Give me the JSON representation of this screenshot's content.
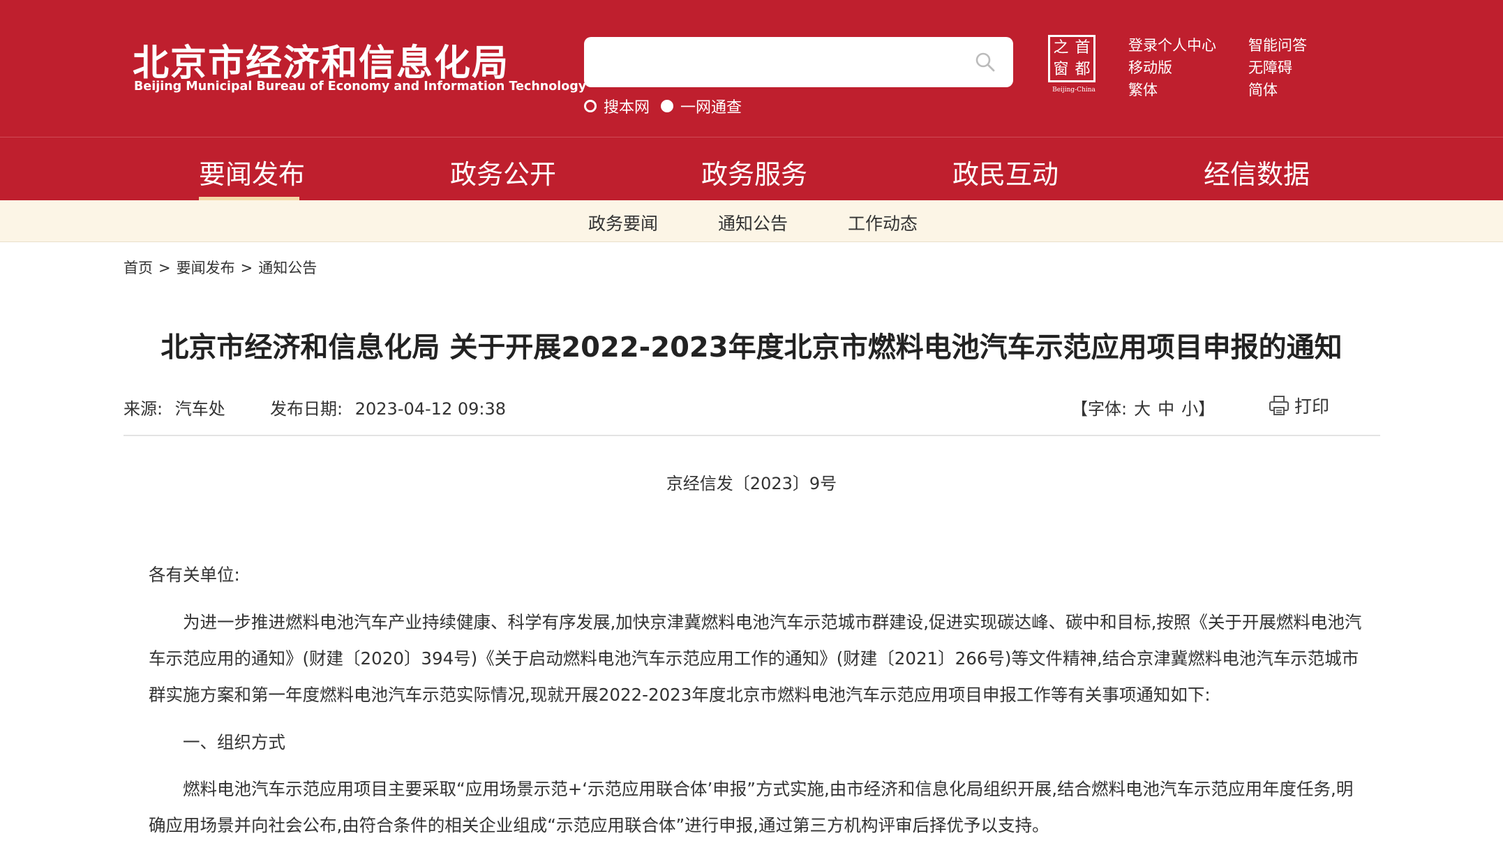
{
  "header": {
    "org_name_cn": "北京市经济和信息化局",
    "org_name_en": "Beijing Municipal Bureau of Economy and Information Technology",
    "search": {
      "placeholder": "",
      "options": [
        "搜本网",
        "一网通查"
      ]
    },
    "seal": {
      "chars": [
        "之",
        "首",
        "窗",
        "都"
      ],
      "caption": "Beijing-China"
    },
    "top_links": [
      "登录个人中心",
      "智能问答",
      "移动版",
      "无障碍",
      "繁体",
      "简体"
    ],
    "colors": {
      "primary": "#bf1f2e",
      "subnav_bg": "#fcf5e6",
      "active_underline": "#f4d7a6"
    }
  },
  "nav": {
    "items": [
      "要闻发布",
      "政务公开",
      "政务服务",
      "政民互动",
      "经信数据"
    ],
    "active": "要闻发布"
  },
  "subnav": {
    "items": [
      "政务要闻",
      "通知公告",
      "工作动态"
    ]
  },
  "breadcrumb": {
    "items": [
      "首页",
      "要闻发布",
      "通知公告"
    ],
    "separator": ">"
  },
  "article": {
    "title": "北京市经济和信息化局 关于开展2022-2023年度北京市燃料电池汽车示范应用项目申报的通知",
    "source_label": "来源:",
    "source": "汽车处",
    "date_label": "发布日期:",
    "date": "2023-04-12 09:38",
    "font_label": "【字体:",
    "font_sizes": [
      "大",
      "中",
      "小"
    ],
    "font_close": "】",
    "print_label": "打印",
    "doc_number": "京经信发〔2023〕9号",
    "salutation": "各有关单位:",
    "paragraphs": [
      "为进一步推进燃料电池汽车产业持续健康、科学有序发展,加快京津冀燃料电池汽车示范城市群建设,促进实现碳达峰、碳中和目标,按照《关于开展燃料电池汽车示范应用的通知》(财建〔2020〕394号)《关于启动燃料电池汽车示范应用工作的通知》(财建〔2021〕266号)等文件精神,结合京津冀燃料电池汽车示范城市群实施方案和第一年度燃料电池汽车示范实际情况,现就开展2022-2023年度北京市燃料电池汽车示范应用项目申报工作等有关事项通知如下:",
      "一、组织方式",
      "燃料电池汽车示范应用项目主要采取“应用场景示范+‘示范应用联合体’申报”方式实施,由市经济和信息化局组织开展,结合燃料电池汽车示范应用年度任务,明确应用场景并向社会公布,由符合条件的相关企业组成“示范应用联合体”进行申报,通过第三方机构评审后择优予以支持。"
    ]
  }
}
